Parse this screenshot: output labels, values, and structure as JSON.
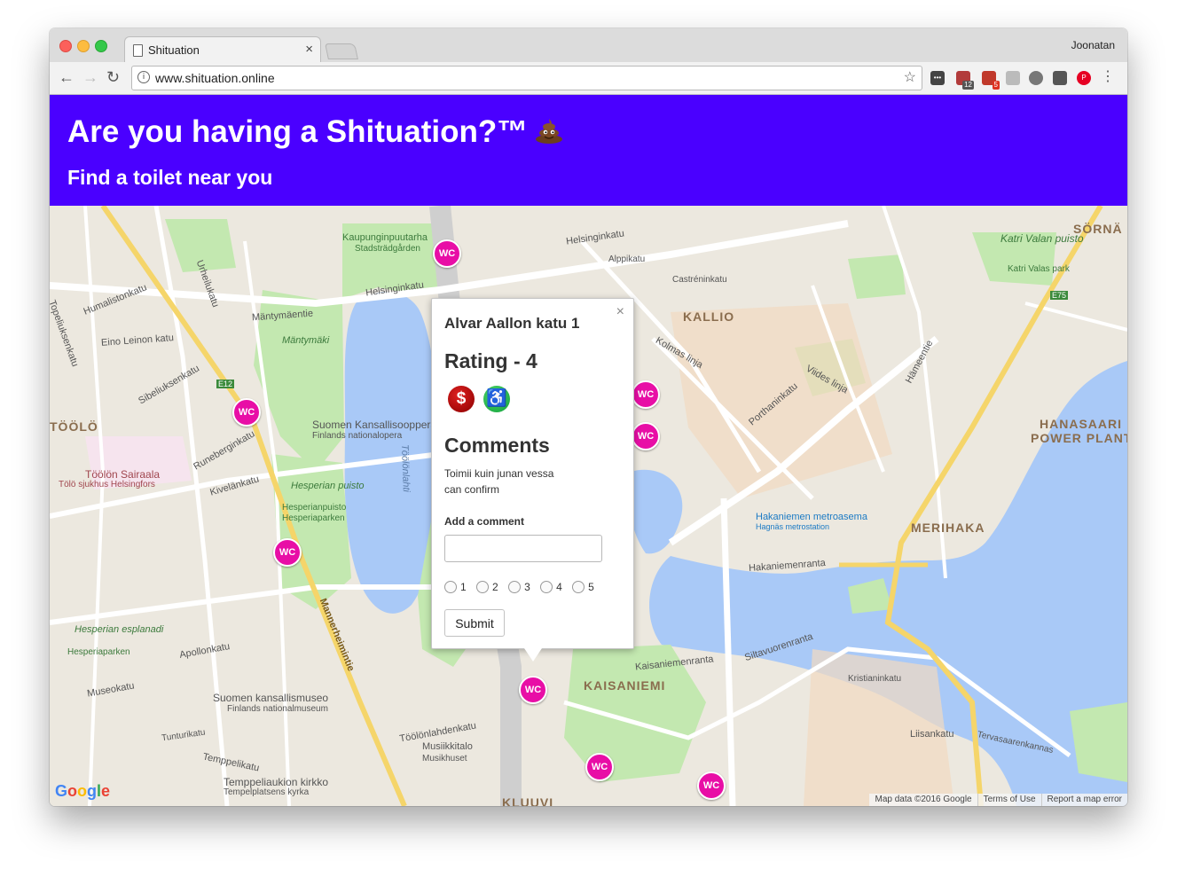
{
  "browser": {
    "tab_title": "Shituation",
    "tab_close": "×",
    "profile_name": "Joonatan",
    "url": "www.shituation.online",
    "extension_badges": [
      "12",
      "5"
    ]
  },
  "header": {
    "title": "Are you having a Shituation?™",
    "subtitle": "Find a toilet near you",
    "background": "#4a00ff"
  },
  "map": {
    "marker_label": "WC",
    "marker_color": "#e80ea6",
    "labels": {
      "kallio": "KALLIO",
      "toolo": "TÖÖLÖ",
      "kaisaniemi": "KAISANIEMI",
      "merihaka": "MERIHAKA",
      "hanasaari": "HANASAARI",
      "power_plant": "POWER PLANT",
      "sornainen": "SÖRNÄ",
      "kluuvi": "KLUUVI",
      "tooloonlahti": "Töölönlahti",
      "kaupunginpuutarha": "Kaupunginpuutarha",
      "stadsradgarden": "Stadsträdgården",
      "helsinginkatu": "Helsinginkatu",
      "helsinginkatu2": "Helsinginkatu",
      "mantymaentie": "Mäntymäentie",
      "mantymaki": "Mäntymäki",
      "eino_leinon_katu": "Eino Leinon katu",
      "humalistonkatu": "Humalistonkatu",
      "sibeliuksenkatu": "Sibeliuksenkatu",
      "suomen_kansallisooppera": "Suomen Kansallisooppera",
      "finlands_nationalopera": "Finlands nationalopera",
      "toolon_sairaala": "Töölön Sairaala",
      "tolo_sjukhus": "Tölö sjukhus Helsingfors",
      "runeberginkatu": "Runeberginkatu",
      "kivelankatu": "Kivelänkatu",
      "hesperian_puisto": "Hesperian puisto",
      "hesperianpuisto": "Hesperianpuisto",
      "hesperiaparken": "Hesperiaparken",
      "hesperian_esplanadi": "Hesperian esplanadi",
      "hesperiaparken2": "Hesperiaparken",
      "apollonkatu": "Apollonkatu",
      "museokatu": "Museokatu",
      "suomen_kansallismuseo": "Suomen kansallismuseo",
      "finlands_nationalmuseum": "Finlands nationalmuseum",
      "tunturikatu": "Tunturikatu",
      "temppelikatu": "Temppelikatu",
      "temppeliaukion_kirkko": "Temppeliaukion kirkko",
      "tempelplatsens_kyrka": "Tempelplatsens kyrka",
      "musiikkitalo": "Musiikkitalo",
      "musikhuset": "Musikhuset",
      "toolonlahdenkatu": "Töölönlahdenkatu",
      "mannerheimintie": "Mannerheimintie",
      "hakaniemen_metroasema": "Hakaniemen metroasema",
      "hagnas_metrostation": "Hagnäs metrostation",
      "hakaniemenranta": "Hakaniemenranta",
      "kaisaniemenranta": "Kaisaniemenranta",
      "siltavuorenranta": "Siltavuorenranta",
      "kristianinkatu": "Kristianinkatu",
      "liisankatu": "Liisankatu",
      "tervasaarenkannas": "Tervasaarenkannas",
      "katri_valan_puisto": "Katri Valan puisto",
      "katri_valas_park": "Katri Valas park",
      "hameentie": "Hämeentie",
      "porthaninkatu": "Porthaninkatu",
      "kolmas_linja": "Kolmas linja",
      "viides_linja": "Viides linja",
      "castreninkatu": "Castréninkatu",
      "alppikatu": "Alppikatu",
      "urheilukatu": "Urheilukatu",
      "topeliuksenkatu": "Topeliuksenkatu",
      "e12": "E12",
      "e75": "E75"
    },
    "attribution": {
      "map_data": "Map data ©2016 Google",
      "terms": "Terms of Use",
      "report": "Report a map error"
    },
    "google_logo": "Google"
  },
  "infowindow": {
    "title": "Alvar Aallon katu 1",
    "rating": "Rating - 4",
    "close": "×",
    "paid_icon": "dollar-icon",
    "accessible_icon": "wheelchair-icon",
    "comments_heading": "Comments",
    "comments": [
      "Toimii kuin junan vessa",
      "can confirm"
    ],
    "add_comment_label": "Add a comment",
    "comment_value": "",
    "rating_options": [
      "1",
      "2",
      "3",
      "4",
      "5"
    ],
    "submit_label": "Submit"
  }
}
